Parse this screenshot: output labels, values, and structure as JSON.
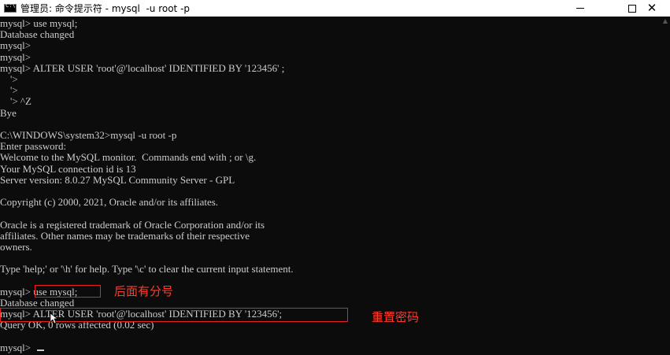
{
  "window": {
    "title": "管理员: 命令提示符 - mysql  -u root -p",
    "icon": "cmd-icon"
  },
  "controls": {
    "minimize": "minimize-icon",
    "maximize": "maximize-icon",
    "close": "close-icon",
    "close_glyph": "✕"
  },
  "console": {
    "lines": [
      "mysql> use mysql;",
      "Database changed",
      "mysql>",
      "mysql>",
      "mysql> ALTER USER 'root'@'localhost' IDENTIFIED BY '123456' ;",
      "    '>",
      "    '>",
      "    '> ^Z",
      "Bye",
      "",
      "C:\\WINDOWS\\system32>mysql -u root -p",
      "Enter password:",
      "Welcome to the MySQL monitor.  Commands end with ; or \\g.",
      "Your MySQL connection id is 13",
      "Server version: 8.0.27 MySQL Community Server - GPL",
      "",
      "Copyright (c) 2000, 2021, Oracle and/or its affiliates.",
      "",
      "Oracle is a registered trademark of Oracle Corporation and/or its",
      "affiliates. Other names may be trademarks of their respective",
      "owners.",
      "",
      "Type 'help;' or '\\h' for help. Type '\\c' to clear the current input statement.",
      "",
      "mysql> use mysql;",
      "Database changed",
      "mysql> ALTER USER 'root'@'localhost' IDENTIFIED BY '123456';",
      "Query OK, 0 rows affected (0.02 sec)",
      "",
      "mysql>"
    ]
  },
  "annotations": {
    "semicolon_note": "后面有分号",
    "reset_password_note": "重置密码",
    "color": "#ff3b2e"
  }
}
